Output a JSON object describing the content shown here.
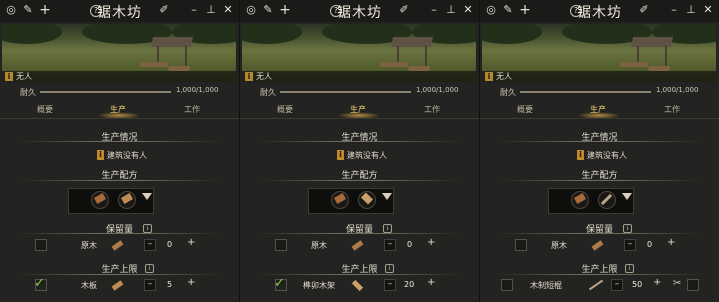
{
  "panels": [
    {
      "title": "锯木坊",
      "image_caption": "无人",
      "durability": {
        "label": "耐久",
        "value": "1,000/1,000",
        "fraction": 1.0
      },
      "tabs": [
        "概要",
        "生产",
        "工作"
      ],
      "active_tab": 1,
      "production_status": {
        "title": "生产情况",
        "message": "建筑没有人"
      },
      "recipe": {
        "title": "生产配方",
        "items": [
          "wood-log",
          "wood-plank"
        ]
      },
      "reserve": {
        "title": "保留量",
        "item_label": "原木",
        "checked": false,
        "value": "0"
      },
      "limit": {
        "title": "生产上限",
        "item_label": "木板",
        "checked": true,
        "value": "5"
      }
    },
    {
      "title": "锯木坊",
      "image_caption": "无人",
      "durability": {
        "label": "耐久",
        "value": "1,000/1,000",
        "fraction": 1.0
      },
      "tabs": [
        "概要",
        "生产",
        "工作"
      ],
      "active_tab": 1,
      "production_status": {
        "title": "生产情况",
        "message": "建筑没有人"
      },
      "recipe": {
        "title": "生产配方",
        "items": [
          "wood-log",
          "mortise-tenon-frame"
        ]
      },
      "reserve": {
        "title": "保留量",
        "item_label": "原木",
        "checked": false,
        "value": "0"
      },
      "limit": {
        "title": "生产上限",
        "item_label": "榫卯木架",
        "checked": true,
        "value": "20"
      }
    },
    {
      "title": "锯木坊",
      "image_caption": "无人",
      "durability": {
        "label": "耐久",
        "value": "1,000/1,000",
        "fraction": 1.0
      },
      "tabs": [
        "概要",
        "生产",
        "工作"
      ],
      "active_tab": 1,
      "production_status": {
        "title": "生产情况",
        "message": "建筑没有人"
      },
      "recipe": {
        "title": "生产配方",
        "items": [
          "wood-log",
          "wooden-short-stick"
        ]
      },
      "reserve": {
        "title": "保留量",
        "item_label": "原木",
        "checked": false,
        "value": "0"
      },
      "limit": {
        "title": "生产上限",
        "item_label": "木制短棍",
        "checked": false,
        "value": "50"
      }
    }
  ],
  "icons": {
    "titlebar": [
      "eye-cycle-icon",
      "broom-icon",
      "plus-icon",
      "help-icon",
      "rename-pen-icon",
      "minimize-icon",
      "pin-icon",
      "close-icon"
    ]
  },
  "colors": {
    "accent": "#f0ca72",
    "warning": "#c08a26",
    "check": "#7fd04b"
  }
}
